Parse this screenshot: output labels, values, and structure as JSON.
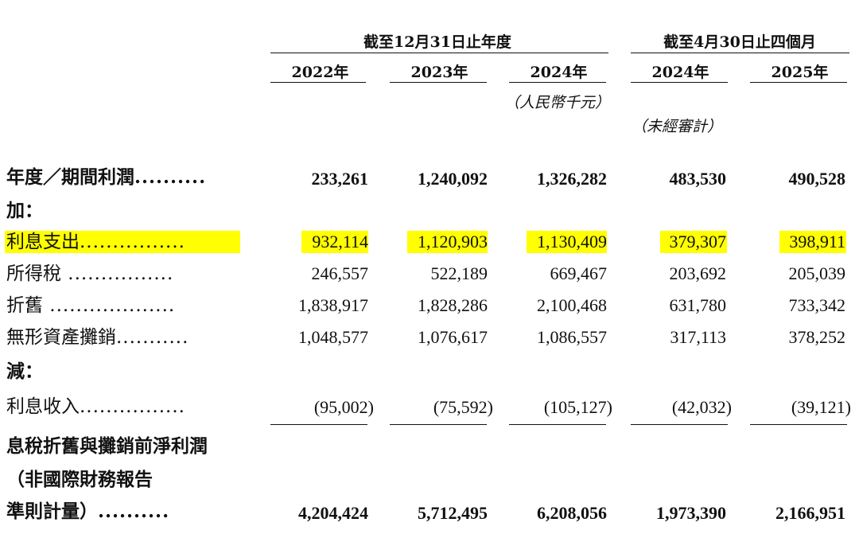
{
  "header": {
    "group_fy": "截至12月31日止年度",
    "group_4m": "截至4月30日止四個月",
    "years": [
      "2022年",
      "2023年",
      "2024年",
      "2024年",
      "2025年"
    ],
    "unit_note": "（人民幣千元）",
    "audit_note": "（未經審計）"
  },
  "rows": {
    "profit": {
      "label": "年度／期間利潤",
      "leader": "..........",
      "values": [
        "233,261",
        "1,240,092",
        "1,326,282",
        "483,530",
        "490,528"
      ]
    },
    "add": {
      "label": "加："
    },
    "interest_exp": {
      "label": "利息支出",
      "leader": "................",
      "values": [
        "932,114",
        "1,120,903",
        "1,130,409",
        "379,307",
        "398,911"
      ]
    },
    "tax": {
      "label": "所得稅",
      "leader": " ................",
      "values": [
        "246,557",
        "522,189",
        "669,467",
        "203,692",
        "205,039"
      ]
    },
    "depreciation": {
      "label": "折舊",
      "leader": " ...................",
      "values": [
        "1,838,917",
        "1,828,286",
        "2,100,468",
        "631,780",
        "733,342"
      ]
    },
    "amortization": {
      "label": "無形資產攤銷",
      "leader": "...........",
      "values": [
        "1,048,577",
        "1,076,617",
        "1,086,557",
        "317,113",
        "378,252"
      ]
    },
    "less": {
      "label": "減："
    },
    "interest_inc": {
      "label": "利息收入",
      "leader": "................",
      "values": [
        "(95,002)",
        "(75,592)",
        "(105,127)",
        "(42,032)",
        "(39,121)"
      ]
    },
    "ebitda": {
      "label_line1": "息稅折舊與攤銷前淨利潤",
      "label_line2": "（非國際財務報告",
      "label_line3": "準則計量）",
      "leader": "..........",
      "values": [
        "4,204,424",
        "5,712,495",
        "6,208,056",
        "1,973,390",
        "2,166,951"
      ]
    }
  },
  "colors": {
    "highlight": "#ffff00",
    "text": "#111111"
  }
}
